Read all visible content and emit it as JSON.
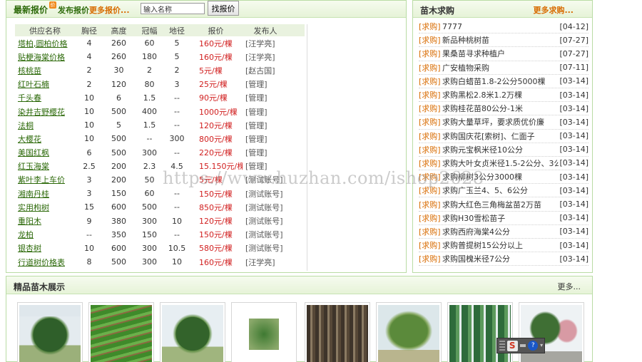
{
  "quotes": {
    "title": "最新报价",
    "badge": "价",
    "post_label": "发布报价",
    "more_label": "更多报价...",
    "search_placeholder": "输入名称",
    "search_button": "找报价",
    "columns": [
      "供应名称",
      "胸径",
      "高度",
      "冠幅",
      "地径",
      "报价",
      "发布人"
    ],
    "rows": [
      [
        "塔柏,圆柏价格",
        "4",
        "260",
        "60",
        "5",
        "160元/棵",
        "[汪学亮]"
      ],
      [
        "贴梗海棠价格",
        "4",
        "260",
        "180",
        "5",
        "160元/棵",
        "[汪学亮]"
      ],
      [
        "核桃苗",
        "2",
        "30",
        "2",
        "2",
        "5元/棵",
        "[赵古国]"
      ],
      [
        "红叶石楠",
        "2",
        "120",
        "80",
        "3",
        "25元/棵",
        "[管理]"
      ],
      [
        "千头春",
        "10",
        "6",
        "1.5",
        "--",
        "90元/棵",
        "[管理]"
      ],
      [
        "染井吉野樱花",
        "10",
        "500",
        "400",
        "--",
        "1000元/棵",
        "[管理]"
      ],
      [
        "法桐",
        "10",
        "5",
        "1.5",
        "--",
        "120元/棵",
        "[管理]"
      ],
      [
        "大樱花",
        "10",
        "500",
        "--",
        "300",
        "800元/棵",
        "[管理]"
      ],
      [
        "美国红枫",
        "6",
        "500",
        "300",
        "--",
        "220元/棵",
        "[管理]"
      ],
      [
        "红玉海棠",
        "2.5",
        "200",
        "2.3",
        "4.5",
        "15.150元/棵",
        "[管理]"
      ],
      [
        "紫叶李上车价",
        "3",
        "200",
        "50",
        "",
        "5元/棵",
        "[测试账号]"
      ],
      [
        "湘南丹桂",
        "3",
        "150",
        "60",
        "--",
        "150元/棵",
        "[测试账号]"
      ],
      [
        "实用枸树",
        "15",
        "600",
        "500",
        "--",
        "850元/棵",
        "[测试账号]"
      ],
      [
        "重阳木",
        "9",
        "380",
        "300",
        "10",
        "120元/棵",
        "[测试账号]"
      ],
      [
        "龙柏",
        "--",
        "350",
        "150",
        "--",
        "150元/棵",
        "[测试账号]"
      ],
      [
        "银杏树",
        "10",
        "600",
        "300",
        "10.5",
        "580元/棵",
        "[测试账号]"
      ],
      [
        "行道树价格表",
        "8",
        "500",
        "300",
        "10",
        "160元/棵",
        "[汪学亮]"
      ]
    ]
  },
  "purchase": {
    "title": "苗木求购",
    "more_label": "更多求购...",
    "tag": "[求购]",
    "items": [
      {
        "text": "7777",
        "date": "[04-12]"
      },
      {
        "text": "新品种桃树苗",
        "date": "[07-27]"
      },
      {
        "text": "果桑苗寻求种植户",
        "date": "[07-27]"
      },
      {
        "text": "广安植物采购",
        "date": "[07-11]"
      },
      {
        "text": "求购白蜡苗1.8-2公分5000棵",
        "date": "[03-14]"
      },
      {
        "text": "求购黑松2.8米1.2万棵",
        "date": "[03-14]"
      },
      {
        "text": "求购桂花苗80公分-1米",
        "date": "[03-14]"
      },
      {
        "text": "求购大量草坪，要求质优价廉",
        "date": "[03-14]"
      },
      {
        "text": "求购国庆花[索树]、仁面子",
        "date": "[03-14]"
      },
      {
        "text": "求购元宝枫米径10公分",
        "date": "[03-14]"
      },
      {
        "text": "求购大叶女贞米径1.5-2公分、3公",
        "date": "[03-14]"
      },
      {
        "text": "求购柳树3公分3000棵",
        "date": "[03-14]"
      },
      {
        "text": "求购广玉兰4、5、6公分",
        "date": "[03-14]"
      },
      {
        "text": "求购大红色三角梅盆苗2万苗",
        "date": "[03-14]"
      },
      {
        "text": "求购H30雪松苗子",
        "date": "[03-14]"
      },
      {
        "text": "求购西府海棠4公分",
        "date": "[03-14]"
      },
      {
        "text": "求购普提树15公分以上",
        "date": "[03-14]"
      },
      {
        "text": "求购国槐米径7公分",
        "date": "[03-14]"
      }
    ]
  },
  "showcase": {
    "title": "精品苗木展示",
    "more_label": "更多...",
    "thumbnails": [
      "pine-tree",
      "seedling-field",
      "pine-tree-2",
      "small-tree",
      "bare-root-stems",
      "broadleaf-tree",
      "cypress-row",
      "flowering-tree"
    ]
  },
  "watermark": "https://www.huzhan.com/ishop2628",
  "ime": {
    "logo": "S",
    "help": "?"
  }
}
